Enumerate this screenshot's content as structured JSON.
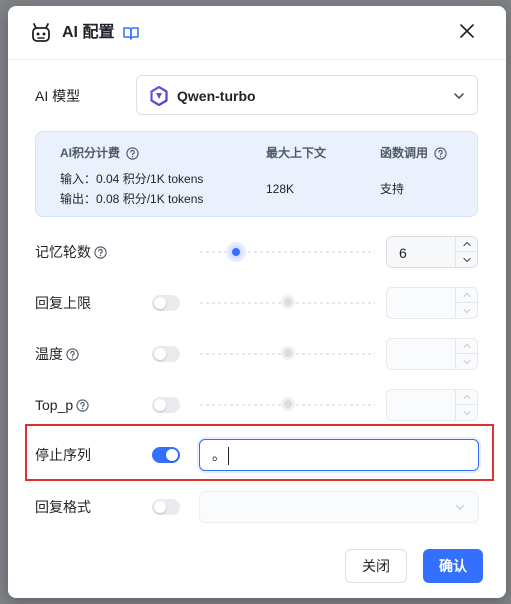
{
  "dialog": {
    "title": "AI 配置",
    "close_icon": "close-icon",
    "book_icon": "book-open-icon",
    "robot_icon": "robot-icon"
  },
  "model": {
    "label": "AI 模型",
    "selected": "Qwen-turbo",
    "icon": "qwen-logo-icon"
  },
  "info": {
    "col1_header": "AI积分计费",
    "col2_header": "最大上下文",
    "col3_header": "函数调用",
    "input_price": "输入：0.04 积分/1K tokens",
    "output_price": "输出：0.08 积分/1K tokens",
    "max_context": "128K",
    "function_call": "支持"
  },
  "settings": {
    "memory_rounds": {
      "label": "记忆轮数",
      "value": "6",
      "slider_fraction": 0.2
    },
    "max_reply": {
      "label": "回复上限",
      "enabled": false
    },
    "temperature": {
      "label": "温度",
      "enabled": false
    },
    "top_p": {
      "label": "Top_p",
      "enabled": false
    },
    "stop_sequence": {
      "label": "停止序列",
      "enabled": true,
      "value": "。"
    },
    "reply_format": {
      "label": "回复格式",
      "enabled": false
    }
  },
  "buttons": {
    "cancel": "关闭",
    "confirm": "确认"
  },
  "colors": {
    "accent": "#3370ff",
    "info_bg": "#eaf1fd",
    "highlight": "#e03131"
  }
}
